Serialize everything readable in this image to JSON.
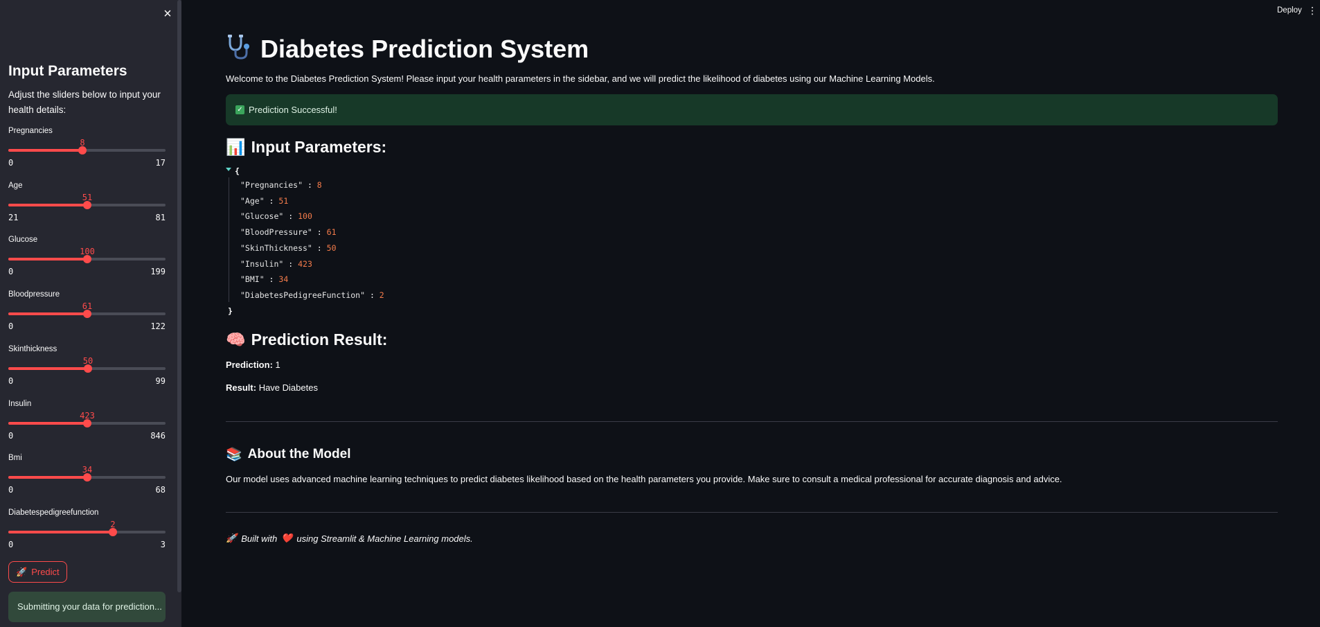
{
  "sidebar": {
    "close_icon": "×",
    "title": "Input Parameters",
    "description": "Adjust the sliders below to input your health details:",
    "sliders": [
      {
        "label": "Pregnancies",
        "value": 8,
        "min": 0,
        "max": 17
      },
      {
        "label": "Age",
        "value": 51,
        "min": 21,
        "max": 81
      },
      {
        "label": "Glucose",
        "value": 100,
        "min": 0,
        "max": 199
      },
      {
        "label": "Bloodpressure",
        "value": 61,
        "min": 0,
        "max": 122
      },
      {
        "label": "Skinthickness",
        "value": 50,
        "min": 0,
        "max": 99
      },
      {
        "label": "Insulin",
        "value": 423,
        "min": 0,
        "max": 846
      },
      {
        "label": "Bmi",
        "value": 34,
        "min": 0,
        "max": 68
      },
      {
        "label": "Diabetespedigreefunction",
        "value": 2,
        "min": 0,
        "max": 3
      }
    ],
    "predict_label": "Predict",
    "predict_icon": "🚀",
    "submitting_text": "Submitting your data for prediction..."
  },
  "topbar": {
    "deploy_label": "Deploy",
    "menu_icon": "⋮"
  },
  "main": {
    "title": "Diabetes Prediction System",
    "title_icon": "stethoscope-icon",
    "welcome": "Welcome to the Diabetes Prediction System! Please input your health parameters in the sidebar, and we will predict the likelihood of diabetes using our Machine Learning Models.",
    "success": "Prediction Successful!",
    "input_heading": "Input Parameters:",
    "input_heading_icon": "📊",
    "json_open": "{",
    "json_close": "}",
    "json_rows": [
      {
        "key": "\"Pregnancies\"",
        "value": "8"
      },
      {
        "key": "\"Age\"",
        "value": "51"
      },
      {
        "key": "\"Glucose\"",
        "value": "100"
      },
      {
        "key": "\"BloodPressure\"",
        "value": "61"
      },
      {
        "key": "\"SkinThickness\"",
        "value": "50"
      },
      {
        "key": "\"Insulin\"",
        "value": "423"
      },
      {
        "key": "\"BMI\"",
        "value": "34"
      },
      {
        "key": "\"DiabetesPedigreeFunction\"",
        "value": "2"
      }
    ],
    "result_heading": "Prediction Result:",
    "result_heading_icon": "🧠",
    "prediction_label": "Prediction:",
    "prediction_value": "1",
    "result_label": "Result:",
    "result_value": "Have Diabetes",
    "about_heading": "About the Model",
    "about_heading_icon": "📚",
    "about_text": "Our model uses advanced machine learning techniques to predict diabetes likelihood based on the health parameters you provide. Make sure to consult a medical professional for accurate diagnosis and advice.",
    "footer_icon": "🚀",
    "footer_pre": "Built with",
    "footer_heart": "❤️",
    "footer_post": "using Streamlit & Machine Learning models."
  },
  "colors": {
    "accent": "#ff4b4b",
    "background": "#0e1117",
    "sidebar": "#262730",
    "success_bg": "#173928",
    "json_number": "#f57c4b"
  }
}
